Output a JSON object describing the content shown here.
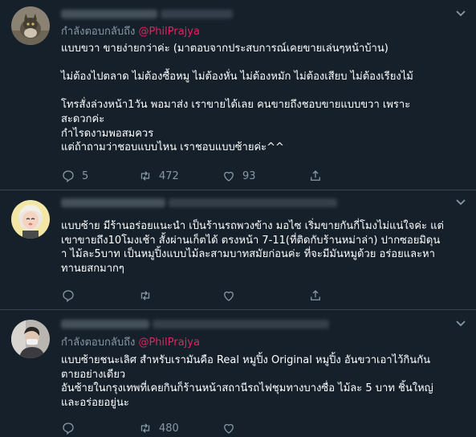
{
  "colors": {
    "background": "#15202b",
    "muted": "#8899a6",
    "mention": "#e0245e",
    "divider": "#38444d"
  },
  "tweets": [
    {
      "reply_prefix": "กำลังตอบกลับถึง",
      "reply_handle": "@PhilPrajya",
      "text": "แบบขวา ขายง่ายกว่าค่ะ (มาตอบจากประสบการณ์เคยขายเล่นๆหน้าบ้าน)\n\nไม่ต้องไปตลาด ไม่ต้องซื้อหมู ไม่ต้องหั่น ไม่ต้องหมัก ไม่ต้องเสียบ ไม่ต้องเรียงไม้\n\nโทรสั่งล่วงหน้า1วัน พอมาส่ง เราขายได้เลย คนขายถึงชอบขายแบบขวา เพราะ\nสะดวกค่ะ\nกำไรดงามพอสมควร\nแต่ถ้าถามว่าชอบแบบไหน เราชอบแบบซ้ายค่ะ^^",
      "replies": "5",
      "retweets": "472",
      "likes": "93"
    },
    {
      "text": "แบบซ้าย มีร้านอร่อยแนะนำ เป็นร้านรถพวงข้าง มอไซ เริ่มขายกันกี่โมงไม่แน่ใจค่ะ แต่\nเขาขายถึง10โมงเช้า สั้งผ่านเก็ตได้ ตรงหน้า 7-11(ที่ติดกับร้านหม่าล่า) ปากซอยมิดุน\nา ไม้ละ5บาท เป็นหมูปิ้งแบบไม้ละสามบาทสมัยก่อนค่ะ ที่จะมีมันหมูด้วย อร่อยและหา\nทานยสกมากๆ"
    },
    {
      "reply_prefix": "กำลังตอบกลับถึง",
      "reply_handle": "@PhilPrajya",
      "text": "แบบซ้ายชนะเลิศ สำหรับเรามันคือ Real หมูปิ้ง Original หมูปิ้ง อันขวาเอาไว้กินกัน\nตายอย่างเดียว\nอันซ้ายในกรุงเทพที่เคยกินก็ร้านหน้าสถานีรถไฟชุมทางบางซื่อ ไม้ละ 5 บาท ชิ้นใหญ่\nและอร่อยอยู่นะ",
      "replies": "",
      "retweets": "480",
      "likes": ""
    }
  ]
}
